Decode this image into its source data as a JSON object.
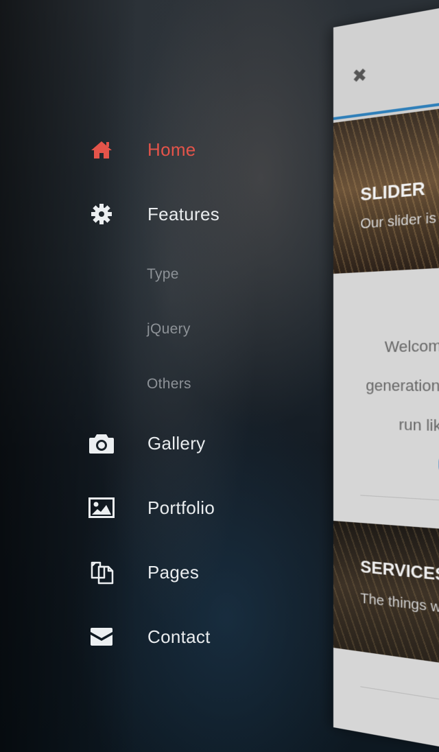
{
  "menu": {
    "items": [
      {
        "label": "Home",
        "icon": "home-icon",
        "active": true
      },
      {
        "label": "Features",
        "icon": "gear-icon"
      },
      {
        "label": "Type",
        "sub": true
      },
      {
        "label": "jQuery",
        "sub": true
      },
      {
        "label": "Others",
        "sub": true
      },
      {
        "label": "Gallery",
        "icon": "camera-icon"
      },
      {
        "label": "Portfolio",
        "icon": "image-icon"
      },
      {
        "label": "Pages",
        "icon": "pages-icon"
      },
      {
        "label": "Contact",
        "icon": "envelope-icon"
      }
    ]
  },
  "panel": {
    "close_glyph": "✖",
    "slider_title": "SLIDER",
    "slider_text": "Our slider is a",
    "welcome_lines": [
      "Welcome",
      "generation r",
      "run like"
    ],
    "services_title": "SERVICES",
    "services_text": "The things we"
  },
  "colors": {
    "accent_active": "#e4544a",
    "accent_blue": "#2f7fb9",
    "menu_text": "#e9ecee",
    "submenu_text": "#8d9297"
  }
}
